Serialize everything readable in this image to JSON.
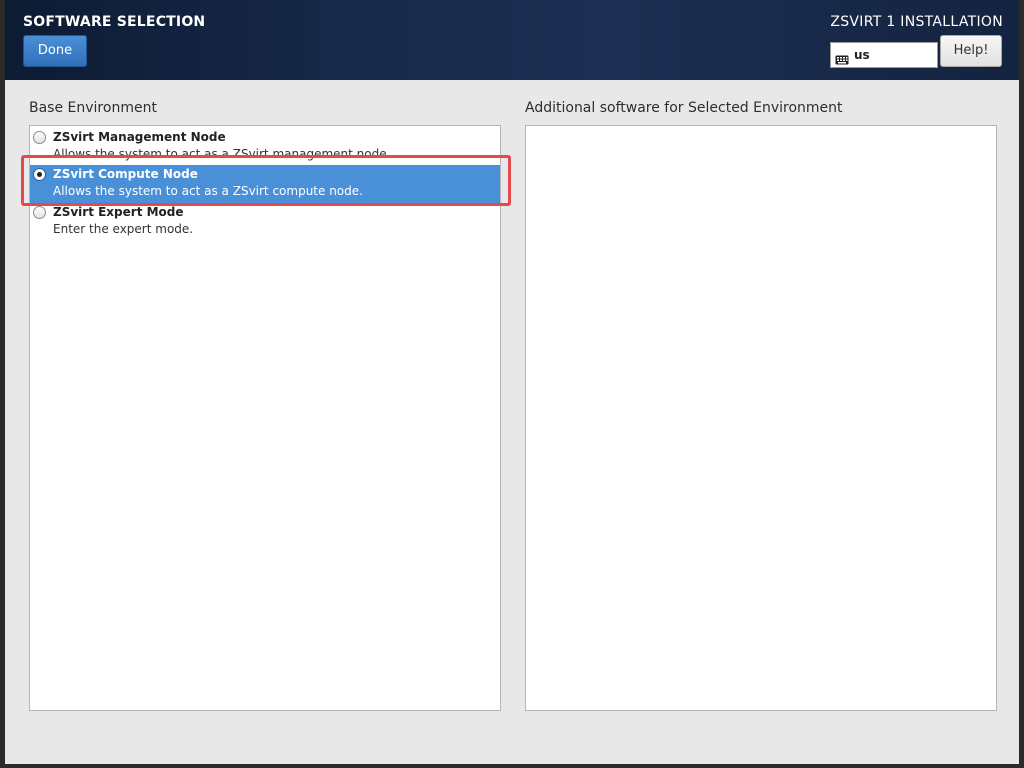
{
  "header": {
    "title": "SOFTWARE SELECTION",
    "done_label": "Done",
    "product": "ZSVIRT 1 INSTALLATION",
    "keyboard_layout": "us",
    "help_label": "Help!"
  },
  "base_environment": {
    "label": "Base Environment",
    "items": [
      {
        "title": "ZSvirt Management Node",
        "description": "Allows the system to act as a ZSvirt management node.",
        "selected": false
      },
      {
        "title": "ZSvirt Compute Node",
        "description": "Allows the system to act as a ZSvirt compute node.",
        "selected": true
      },
      {
        "title": "ZSvirt Expert Mode",
        "description": "Enter the expert mode.",
        "selected": false
      }
    ]
  },
  "additional_software": {
    "label": "Additional software for Selected Environment",
    "items": []
  },
  "colors": {
    "selection": "#4a90d9",
    "highlight_box": "#e54a4a",
    "header_bg": "#18294a"
  }
}
